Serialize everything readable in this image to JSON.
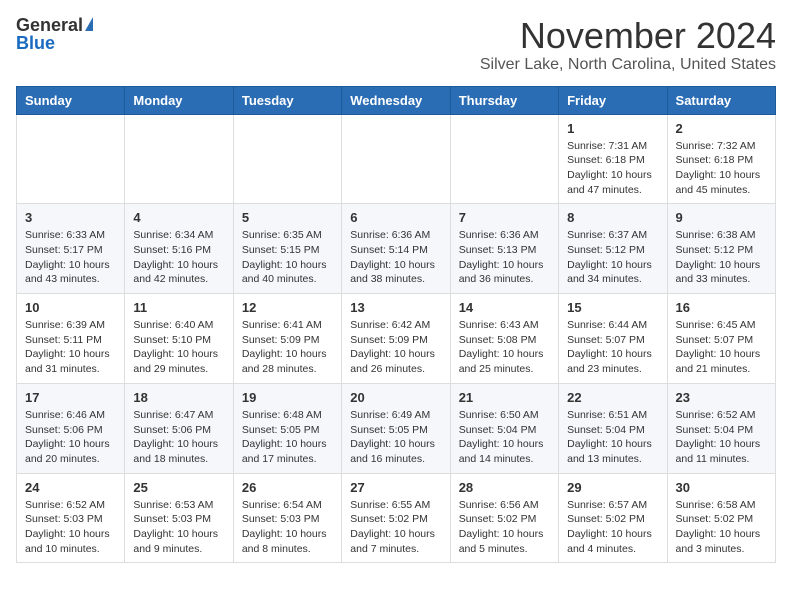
{
  "header": {
    "logo_general": "General",
    "logo_blue": "Blue",
    "month_title": "November 2024",
    "location": "Silver Lake, North Carolina, United States"
  },
  "weekdays": [
    "Sunday",
    "Monday",
    "Tuesday",
    "Wednesday",
    "Thursday",
    "Friday",
    "Saturday"
  ],
  "weeks": [
    [
      {
        "day": "",
        "info": ""
      },
      {
        "day": "",
        "info": ""
      },
      {
        "day": "",
        "info": ""
      },
      {
        "day": "",
        "info": ""
      },
      {
        "day": "",
        "info": ""
      },
      {
        "day": "1",
        "info": "Sunrise: 7:31 AM\nSunset: 6:18 PM\nDaylight: 10 hours\nand 47 minutes."
      },
      {
        "day": "2",
        "info": "Sunrise: 7:32 AM\nSunset: 6:18 PM\nDaylight: 10 hours\nand 45 minutes."
      }
    ],
    [
      {
        "day": "3",
        "info": "Sunrise: 6:33 AM\nSunset: 5:17 PM\nDaylight: 10 hours\nand 43 minutes."
      },
      {
        "day": "4",
        "info": "Sunrise: 6:34 AM\nSunset: 5:16 PM\nDaylight: 10 hours\nand 42 minutes."
      },
      {
        "day": "5",
        "info": "Sunrise: 6:35 AM\nSunset: 5:15 PM\nDaylight: 10 hours\nand 40 minutes."
      },
      {
        "day": "6",
        "info": "Sunrise: 6:36 AM\nSunset: 5:14 PM\nDaylight: 10 hours\nand 38 minutes."
      },
      {
        "day": "7",
        "info": "Sunrise: 6:36 AM\nSunset: 5:13 PM\nDaylight: 10 hours\nand 36 minutes."
      },
      {
        "day": "8",
        "info": "Sunrise: 6:37 AM\nSunset: 5:12 PM\nDaylight: 10 hours\nand 34 minutes."
      },
      {
        "day": "9",
        "info": "Sunrise: 6:38 AM\nSunset: 5:12 PM\nDaylight: 10 hours\nand 33 minutes."
      }
    ],
    [
      {
        "day": "10",
        "info": "Sunrise: 6:39 AM\nSunset: 5:11 PM\nDaylight: 10 hours\nand 31 minutes."
      },
      {
        "day": "11",
        "info": "Sunrise: 6:40 AM\nSunset: 5:10 PM\nDaylight: 10 hours\nand 29 minutes."
      },
      {
        "day": "12",
        "info": "Sunrise: 6:41 AM\nSunset: 5:09 PM\nDaylight: 10 hours\nand 28 minutes."
      },
      {
        "day": "13",
        "info": "Sunrise: 6:42 AM\nSunset: 5:09 PM\nDaylight: 10 hours\nand 26 minutes."
      },
      {
        "day": "14",
        "info": "Sunrise: 6:43 AM\nSunset: 5:08 PM\nDaylight: 10 hours\nand 25 minutes."
      },
      {
        "day": "15",
        "info": "Sunrise: 6:44 AM\nSunset: 5:07 PM\nDaylight: 10 hours\nand 23 minutes."
      },
      {
        "day": "16",
        "info": "Sunrise: 6:45 AM\nSunset: 5:07 PM\nDaylight: 10 hours\nand 21 minutes."
      }
    ],
    [
      {
        "day": "17",
        "info": "Sunrise: 6:46 AM\nSunset: 5:06 PM\nDaylight: 10 hours\nand 20 minutes."
      },
      {
        "day": "18",
        "info": "Sunrise: 6:47 AM\nSunset: 5:06 PM\nDaylight: 10 hours\nand 18 minutes."
      },
      {
        "day": "19",
        "info": "Sunrise: 6:48 AM\nSunset: 5:05 PM\nDaylight: 10 hours\nand 17 minutes."
      },
      {
        "day": "20",
        "info": "Sunrise: 6:49 AM\nSunset: 5:05 PM\nDaylight: 10 hours\nand 16 minutes."
      },
      {
        "day": "21",
        "info": "Sunrise: 6:50 AM\nSunset: 5:04 PM\nDaylight: 10 hours\nand 14 minutes."
      },
      {
        "day": "22",
        "info": "Sunrise: 6:51 AM\nSunset: 5:04 PM\nDaylight: 10 hours\nand 13 minutes."
      },
      {
        "day": "23",
        "info": "Sunrise: 6:52 AM\nSunset: 5:04 PM\nDaylight: 10 hours\nand 11 minutes."
      }
    ],
    [
      {
        "day": "24",
        "info": "Sunrise: 6:52 AM\nSunset: 5:03 PM\nDaylight: 10 hours\nand 10 minutes."
      },
      {
        "day": "25",
        "info": "Sunrise: 6:53 AM\nSunset: 5:03 PM\nDaylight: 10 hours\nand 9 minutes."
      },
      {
        "day": "26",
        "info": "Sunrise: 6:54 AM\nSunset: 5:03 PM\nDaylight: 10 hours\nand 8 minutes."
      },
      {
        "day": "27",
        "info": "Sunrise: 6:55 AM\nSunset: 5:02 PM\nDaylight: 10 hours\nand 7 minutes."
      },
      {
        "day": "28",
        "info": "Sunrise: 6:56 AM\nSunset: 5:02 PM\nDaylight: 10 hours\nand 5 minutes."
      },
      {
        "day": "29",
        "info": "Sunrise: 6:57 AM\nSunset: 5:02 PM\nDaylight: 10 hours\nand 4 minutes."
      },
      {
        "day": "30",
        "info": "Sunrise: 6:58 AM\nSunset: 5:02 PM\nDaylight: 10 hours\nand 3 minutes."
      }
    ]
  ]
}
